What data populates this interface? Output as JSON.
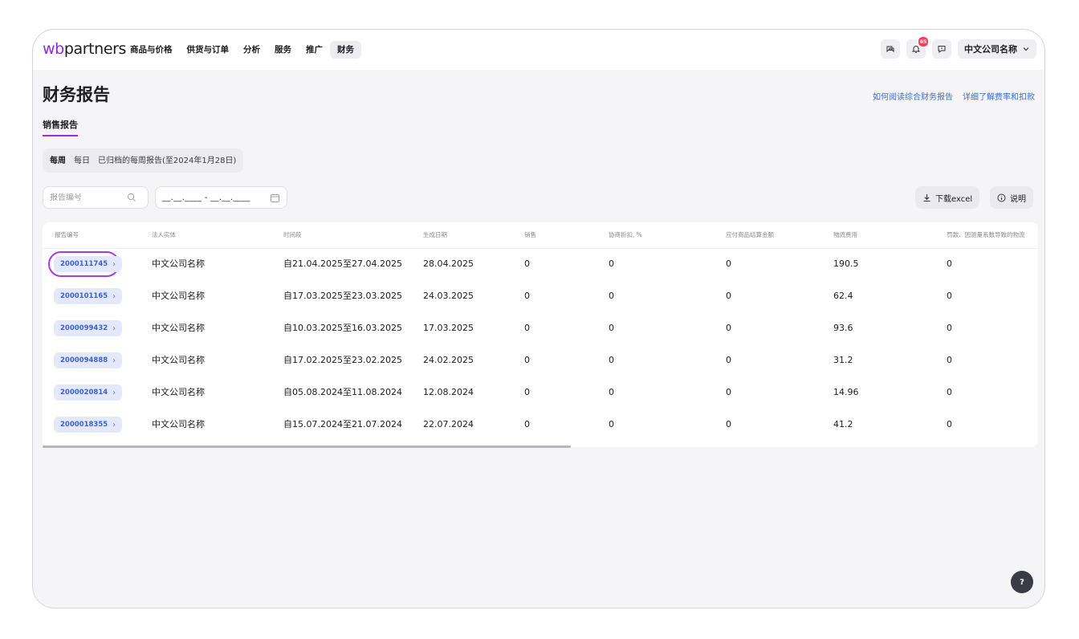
{
  "header": {
    "logo_main": "wb",
    "logo_rest": "partners",
    "nav": [
      {
        "label": "商品与价格"
      },
      {
        "label": "供货与订单"
      },
      {
        "label": "分析"
      },
      {
        "label": "服务"
      },
      {
        "label": "推广"
      },
      {
        "label": "财务"
      }
    ],
    "active_nav": "财务",
    "notifications_count": "65",
    "company": "中文公司名称"
  },
  "page": {
    "title": "财务报告",
    "help_link_1": "如何阅读综合财务报告",
    "help_link_2": "详细了解费率和扣款",
    "subtab": "销售报告"
  },
  "periods": {
    "weekly": "每周",
    "daily": "每日",
    "archived": "已归档的每周报告(至2024年1月28日)"
  },
  "filters": {
    "search_placeholder": "报告编号",
    "date_placeholder": "__.__.____ - __.__.____",
    "download_label": "下载excel",
    "explain_label": "说明"
  },
  "table": {
    "columns": [
      "报告编号",
      "法人实体",
      "时间段",
      "生成日期",
      "销售",
      "协商折扣, %",
      "应付商品结算金额",
      "物流费用",
      "罚款、因测量系数导致的物流"
    ],
    "rows": [
      {
        "id": "2000111745",
        "entity": "中文公司名称",
        "period": "自21.04.2025至27.04.2025",
        "date": "28.04.2025",
        "sales": "0",
        "discount": "0",
        "payable": "0",
        "logistics": "190.5",
        "penalty": "0"
      },
      {
        "id": "2000101165",
        "entity": "中文公司名称",
        "period": "自17.03.2025至23.03.2025",
        "date": "24.03.2025",
        "sales": "0",
        "discount": "0",
        "payable": "0",
        "logistics": "62.4",
        "penalty": "0"
      },
      {
        "id": "2000099432",
        "entity": "中文公司名称",
        "period": "自10.03.2025至16.03.2025",
        "date": "17.03.2025",
        "sales": "0",
        "discount": "0",
        "payable": "0",
        "logistics": "93.6",
        "penalty": "0"
      },
      {
        "id": "2000094888",
        "entity": "中文公司名称",
        "period": "自17.02.2025至23.02.2025",
        "date": "24.02.2025",
        "sales": "0",
        "discount": "0",
        "payable": "0",
        "logistics": "31.2",
        "penalty": "0"
      },
      {
        "id": "2000020814",
        "entity": "中文公司名称",
        "period": "自05.08.2024至11.08.2024",
        "date": "12.08.2024",
        "sales": "0",
        "discount": "0",
        "payable": "0",
        "logistics": "14.96",
        "penalty": "0"
      },
      {
        "id": "2000018355",
        "entity": "中文公司名称",
        "period": "自15.07.2024至21.07.2024",
        "date": "22.07.2024",
        "sales": "0",
        "discount": "0",
        "payable": "0",
        "logistics": "41.2",
        "penalty": "0"
      }
    ]
  },
  "help_fab": "?",
  "colors": {
    "accent_purple": "#a53be0",
    "link_blue": "#3b6fd6",
    "badge_red": "#f0455a",
    "pill_bg": "#e4e8fb"
  },
  "icons": [
    "search-icon",
    "calendar-icon",
    "download-icon",
    "info-circle-icon",
    "chat-icon",
    "bell-icon",
    "message-icon",
    "chevron-down-icon",
    "chevron-right-icon"
  ]
}
